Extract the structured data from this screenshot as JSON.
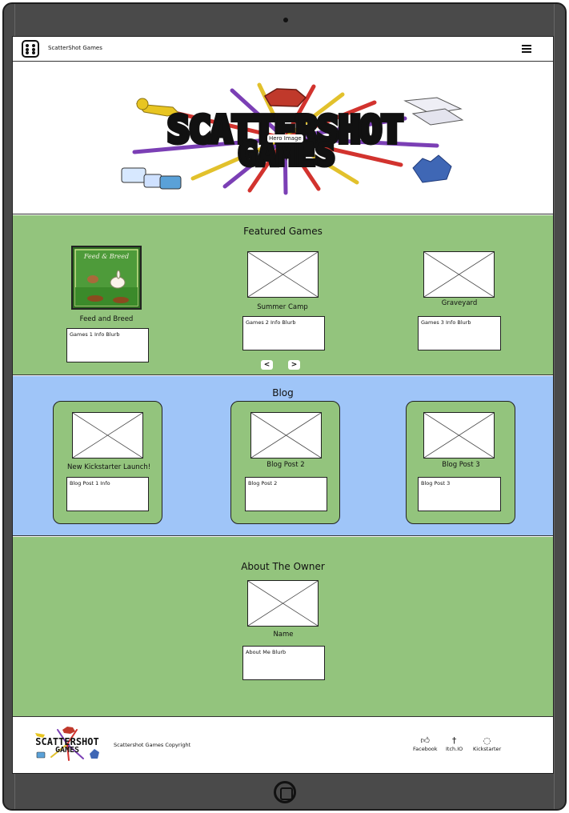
{
  "navbar": {
    "brand": "ScatterShot Games"
  },
  "hero": {
    "label": "Hero Image",
    "logo_line1": "SCATTERSHOT",
    "logo_line2": "GAMES"
  },
  "featured": {
    "title": "Featured Games",
    "games": [
      {
        "name": "Feed and Breed",
        "blurb": "Games 1 Info Blurb",
        "cover_title": "Feed & Breed"
      },
      {
        "name": "Summer Camp",
        "blurb": "Games 2 Info Blurb"
      },
      {
        "name": "Graveyard",
        "blurb": "Games 3 Info Blurb"
      }
    ],
    "prev_label": "<",
    "next_label": ">"
  },
  "blog": {
    "title": "Blog",
    "posts": [
      {
        "name": "New Kickstarter Launch!",
        "blurb": "Blog Post 1 Info"
      },
      {
        "name": "Blog Post 2",
        "blurb": "Blog Post 2"
      },
      {
        "name": "Blog Post 3",
        "blurb": "Blog Post 3"
      }
    ]
  },
  "about": {
    "title": "About The Owner",
    "name": "Name",
    "blurb": "About Me Blurb"
  },
  "footer": {
    "copyright": "Scattershot Games Copyright",
    "logo_line1": "SCATTERSHOT",
    "logo_line2": "GAMES",
    "links": [
      {
        "label": "Facebook",
        "icon": "thumbs-up-icon"
      },
      {
        "label": "Itch.IO",
        "icon": "sword-icon"
      },
      {
        "label": "Kickstarter",
        "icon": "flame-icon"
      }
    ]
  },
  "colors": {
    "green": "#93c47d",
    "blue": "#9fc5f8",
    "bezel": "#4a4a4a"
  }
}
